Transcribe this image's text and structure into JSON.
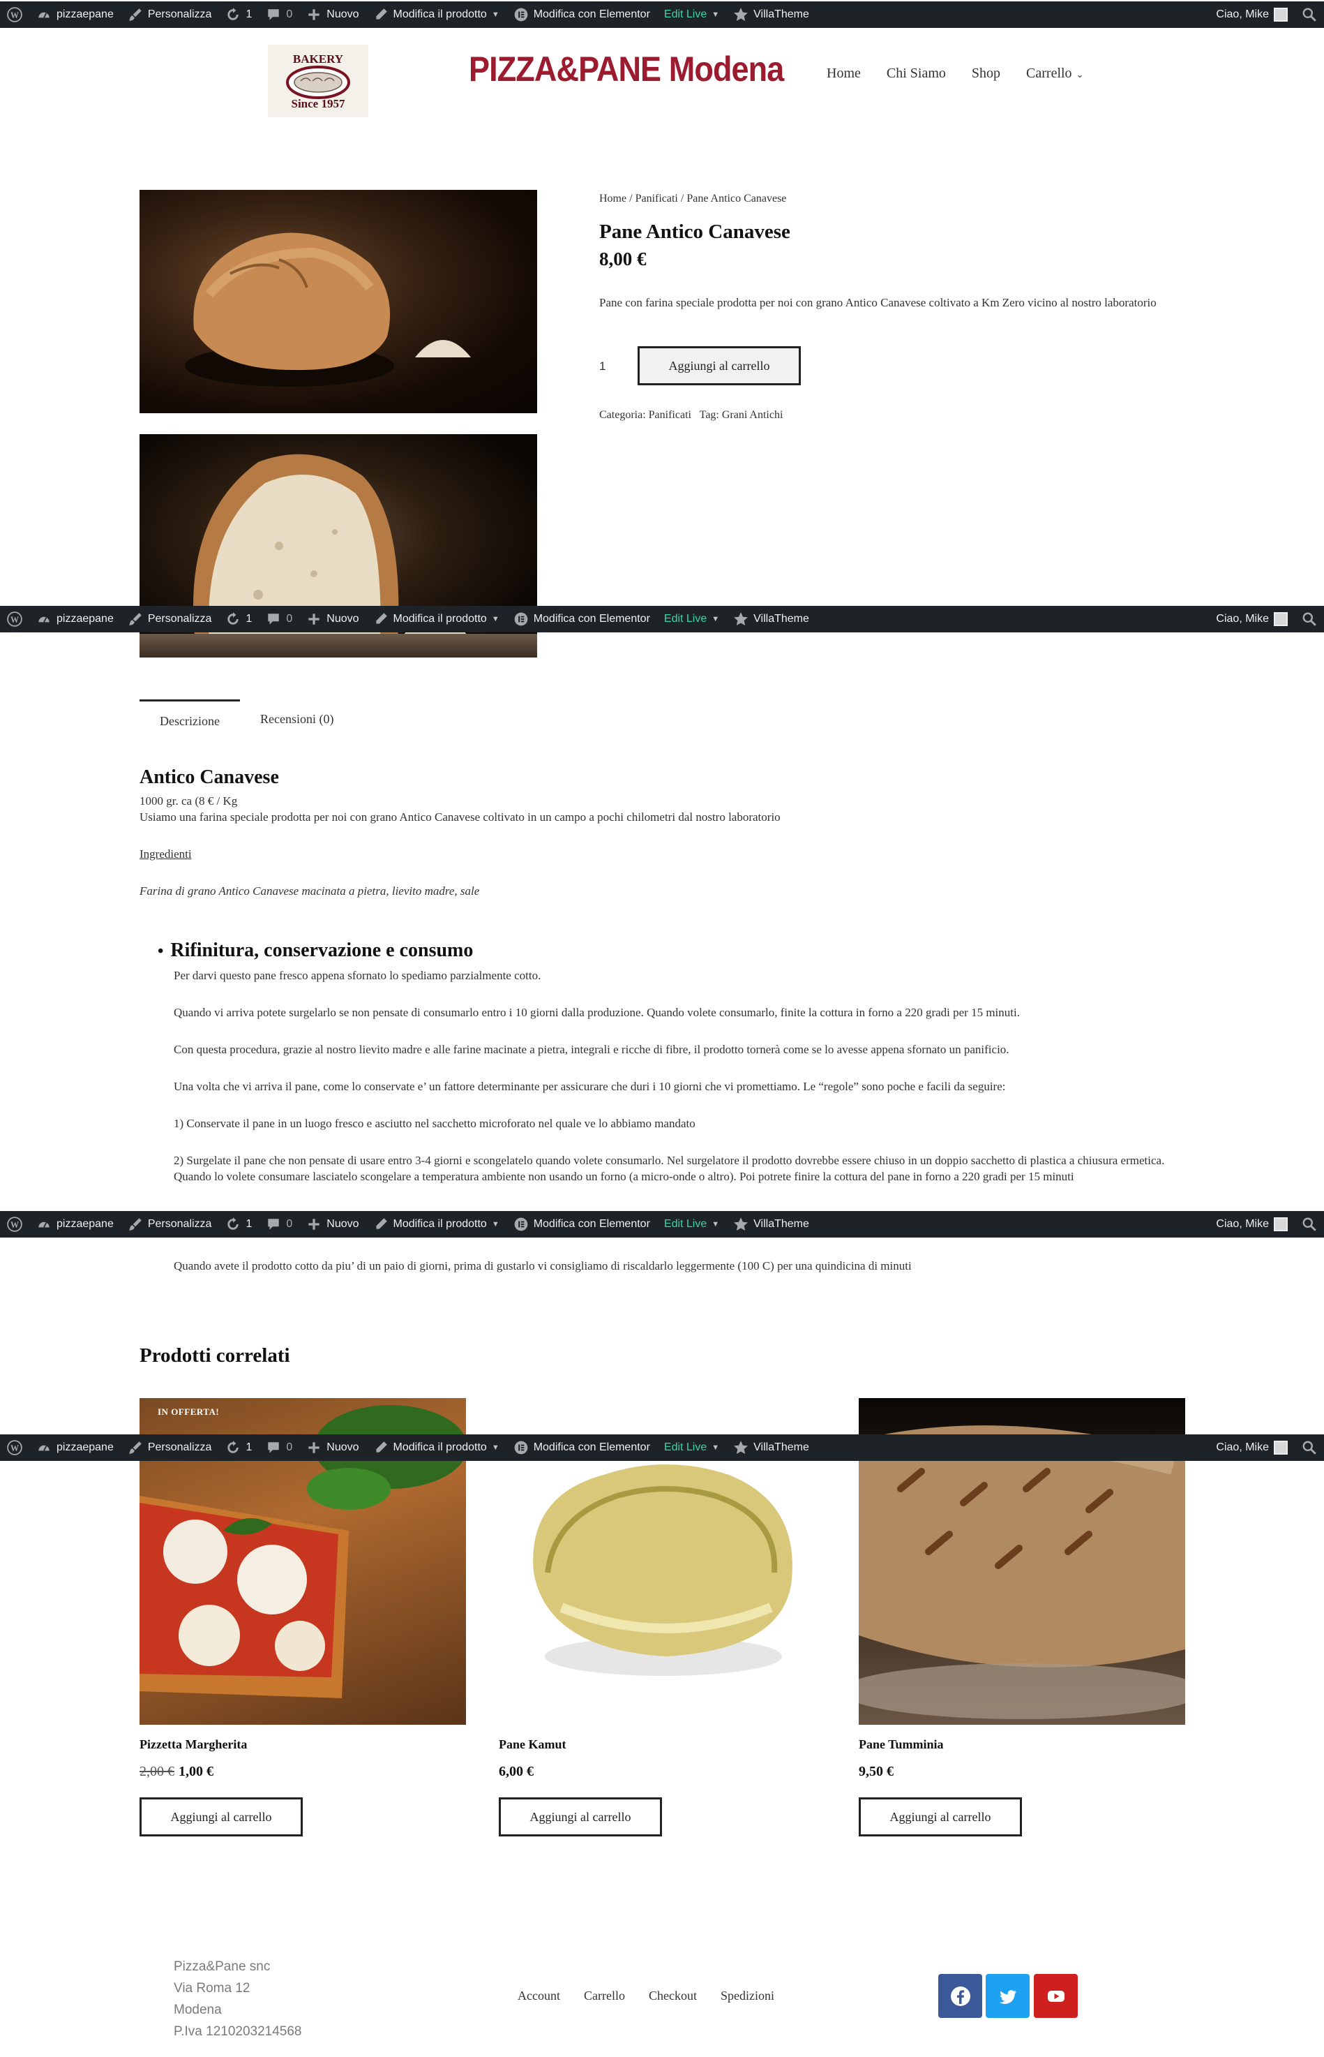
{
  "admin_bar": {
    "site": "pizzaepane",
    "customize": "Personalizza",
    "updates": "1",
    "comments": "0",
    "new": "Nuovo",
    "edit_product": "Modifica il prodotto",
    "elementor": "Modifica con Elementor",
    "edit_live": "Edit Live",
    "villatheme": "VillaTheme",
    "greeting": "Ciao, Mike"
  },
  "header": {
    "logo_line1": "BAKERY",
    "logo_line2": "Since 1957",
    "site_title": "PIZZA&PANE Modena",
    "nav": {
      "home": "Home",
      "about": "Chi Siamo",
      "shop": "Shop",
      "cart": "Carrello"
    }
  },
  "breadcrumb": {
    "home": "Home",
    "sep": "/",
    "category": "Panificati",
    "current": "Pane Antico Canavese"
  },
  "product": {
    "title": "Pane Antico Canavese",
    "price": "8,00 €",
    "short_desc": "Pane con farina speciale prodotta per noi con grano Antico Canavese coltivato a Km Zero vicino al nostro laboratorio",
    "qty": "1",
    "add_to_cart": "Aggiungi al carrello",
    "category_label": "Categoria:",
    "category": "Panificati",
    "tag_label": "Tag:",
    "tag": "Grani Antichi"
  },
  "tabs": {
    "description": "Descrizione",
    "reviews": "Recensioni (0)"
  },
  "description": {
    "heading": "Antico Canavese",
    "weight": "1000 gr. ca (8 € / Kg",
    "intro": "Usiamo una farina speciale prodotta per noi con grano Antico Canavese coltivato in un campo a pochi chilometri dal nostro laboratorio",
    "ingredients_label": "Ingredienti",
    "ingredients": "Farina di grano Antico Canavese macinata a pietra, lievito madre, sale",
    "section_heading": "Rifinitura, conservazione e consumo",
    "paragraphs": [
      "Per darvi questo pane fresco appena sfornato lo spediamo parzialmente cotto.",
      "Quando vi arriva potete surgelarlo se non pensate di consumarlo entro i 10 giorni dalla produzione. Quando volete consumarlo, finite la cottura in forno a 220 gradi per 15 minuti.",
      "Con questa procedura, grazie al nostro lievito madre e alle farine macinate a pietra, integrali e ricche di fibre, il prodotto tornerà  come se lo avesse appena sfornato un panificio.",
      "Una volta che vi arriva il pane, come lo conservate e’ un fattore determinante per assicurare che duri i 10 giorni che vi promettiamo. Le “regole” sono poche e facili da seguire:",
      "1) Conservate il pane in un luogo fresco e asciutto nel sacchetto microforato nel quale ve lo abbiamo mandato",
      "2) Surgelate il pane che non pensate di usare entro 3-4 giorni e scongelatelo quando volete consumarlo. Nel surgelatore il prodotto dovrebbe essere chiuso in un doppio sacchetto di plastica a chiusura ermetica. Quando lo volete consumare lasciatelo scongelare a temperatura ambiente non usando un forno (a micro-onde o altro). Poi potrete finire la cottura del pane in forno a 220 gradi per 15 minuti",
      "Quando avete il prodotto cotto da piu’ di un paio di giorni, prima di gustarlo vi consigliamo di riscaldarlo leggermente (100 C) per una quindicina di minuti"
    ]
  },
  "related": {
    "heading": "Prodotti correlati",
    "products": [
      {
        "name": "Pizzetta Margherita",
        "old_price": "2,00 €",
        "price": "1,00 €",
        "badge": "IN OFFERTA!",
        "button": "Aggiungi al carrello"
      },
      {
        "name": "Pane Kamut",
        "old_price": "",
        "price": "6,00 €",
        "badge": "",
        "button": "Aggiungi al carrello"
      },
      {
        "name": "Pane Tumminia",
        "old_price": "",
        "price": "9,50 €",
        "badge": "",
        "button": "Aggiungi al carrello"
      }
    ]
  },
  "footer": {
    "company": "Pizza&Pane snc",
    "street": "Via Roma 12",
    "city": "Modena",
    "vat": "P.Iva 1210203214568",
    "nav": {
      "account": "Account",
      "cart": "Carrello",
      "checkout": "Checkout",
      "shipping": "Spedizioni"
    },
    "social": {
      "facebook": {
        "icon": "facebook-icon",
        "color": "#3b5998"
      },
      "twitter": {
        "icon": "twitter-icon",
        "color": "#1da1f2"
      },
      "youtube": {
        "icon": "youtube-icon",
        "color": "#cd201f"
      }
    }
  },
  "colors": {
    "admin_bar": "#1d2327",
    "edit_live": "#35d6a4",
    "brand": "#9b1c2e"
  }
}
